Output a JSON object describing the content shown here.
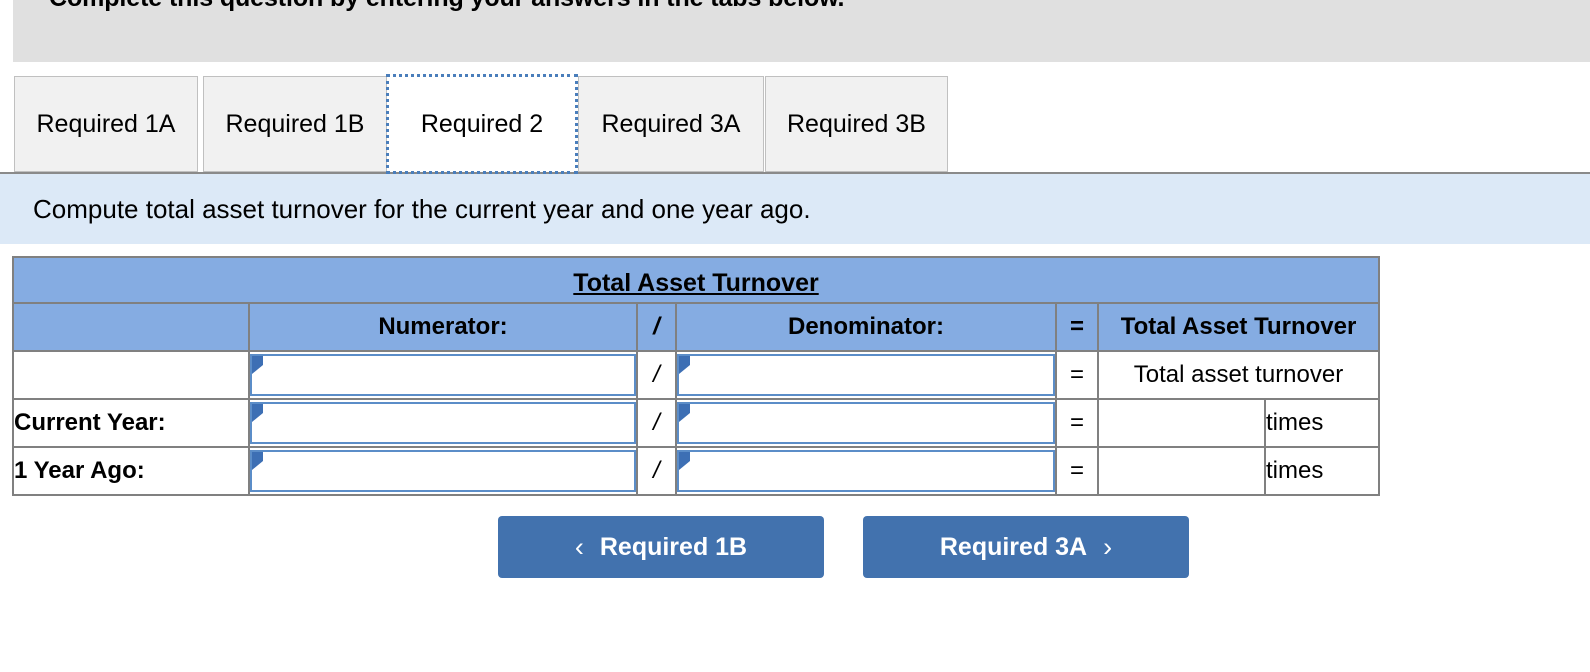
{
  "banner": {
    "text": "Complete this question by entering your answers in the tabs below."
  },
  "tabs": [
    {
      "label": "Required 1A",
      "active": false
    },
    {
      "label": "Required 1B",
      "active": false
    },
    {
      "label": "Required 2",
      "active": true
    },
    {
      "label": "Required 3A",
      "active": false
    },
    {
      "label": "Required 3B",
      "active": false
    }
  ],
  "instruction": {
    "text": "Compute total asset turnover for the current year and one year ago."
  },
  "worksheet": {
    "title": "Total Asset Turnover",
    "columns": {
      "blank": "",
      "numerator": "Numerator:",
      "slash": "/",
      "denominator": "Denominator:",
      "equals": "=",
      "result": "Total Asset Turnover"
    },
    "rows": [
      {
        "label": "",
        "numerator_value": "",
        "slash": "/",
        "denominator_value": "",
        "equals": "=",
        "result_value": "Total asset turnover",
        "unit": ""
      },
      {
        "label": "Current Year:",
        "numerator_value": "",
        "slash": "/",
        "denominator_value": "",
        "equals": "=",
        "result_value": "",
        "unit": "times"
      },
      {
        "label": "1 Year Ago:",
        "numerator_value": "",
        "slash": "/",
        "denominator_value": "",
        "equals": "=",
        "result_value": "",
        "unit": "times"
      }
    ]
  },
  "navigation": {
    "prev_chevron": "‹",
    "prev_label": "Required 1B",
    "next_label": "Required 3A",
    "next_chevron": "›"
  },
  "colors": {
    "header_blue": "#85ace2",
    "instruction_blue": "#dce9f7",
    "banner_gray": "#e0e0e0",
    "button_blue": "#4272ae",
    "input_border": "#5b8dc8",
    "cell_border": "#808080"
  }
}
